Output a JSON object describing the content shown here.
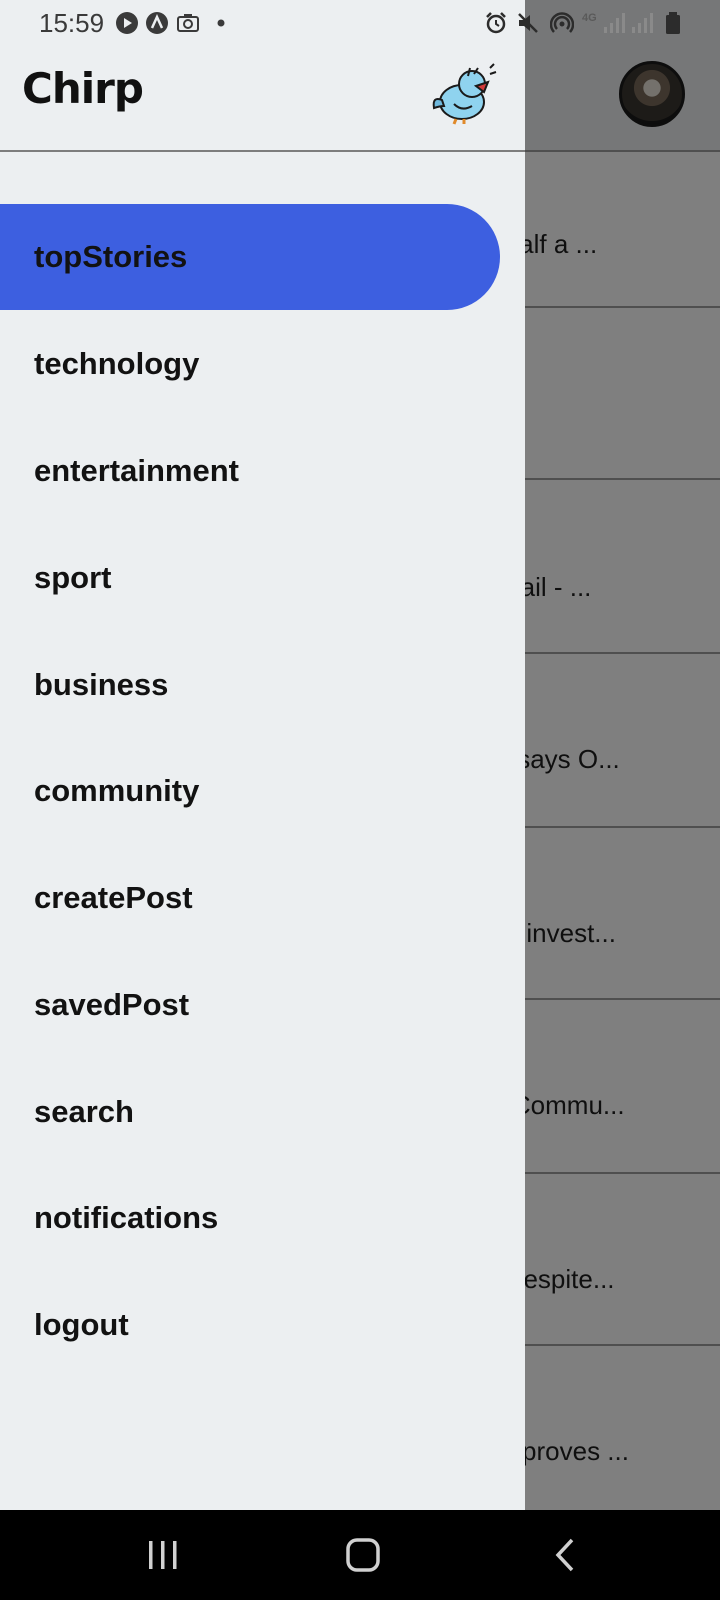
{
  "status_bar": {
    "time": "15:59",
    "left_icons": [
      "play-icon",
      "a-circle-icon",
      "camera-icon",
      "dot-icon"
    ],
    "right_icons": [
      "alarm-icon",
      "mute-icon",
      "hotspot-icon",
      "4g-icon",
      "signal-icon",
      "signal-icon",
      "battery-icon"
    ],
    "network_label": "4G"
  },
  "drawer": {
    "brand": "Chirp",
    "logo_icon": "chirp-bird-logo-icon",
    "accent_color": "#3d5fe0",
    "items": [
      {
        "label": "topStories",
        "active": true
      },
      {
        "label": "technology"
      },
      {
        "label": "entertainment"
      },
      {
        "label": "sport"
      },
      {
        "label": "business"
      },
      {
        "label": "community"
      },
      {
        "label": "createPost"
      },
      {
        "label": "savedPost"
      },
      {
        "label": "search"
      },
      {
        "label": "notifications"
      },
      {
        "label": "logout"
      }
    ]
  },
  "background": {
    "avatar_icon": "user-avatar",
    "feed": [
      {
        "title": "es half a ..."
      },
      {
        "title": ""
      },
      {
        "title": "on bail - ..."
      },
      {
        "title": "pty, says O..."
      },
      {
        "title": "onal invest..."
      },
      {
        "title": "ca: Commu..."
      },
      {
        "title": "es Despite..."
      },
      {
        "title": "rt approves ..."
      }
    ]
  },
  "nav_bar": {
    "buttons": [
      "recent-apps-icon",
      "home-icon",
      "back-icon"
    ]
  }
}
